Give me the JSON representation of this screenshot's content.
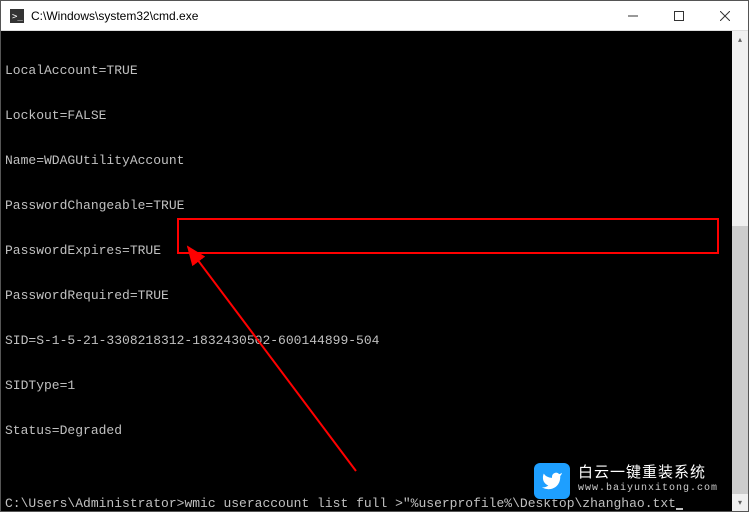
{
  "titlebar": {
    "title": "C:\\Windows\\system32\\cmd.exe"
  },
  "output": {
    "lines": [
      "LocalAccount=TRUE",
      "Lockout=FALSE",
      "Name=WDAGUtilityAccount",
      "PasswordChangeable=TRUE",
      "PasswordExpires=TRUE",
      "PasswordRequired=TRUE",
      "SID=S-1-5-21-3308218312-1832430502-600144899-504",
      "SIDType=1",
      "Status=Degraded"
    ]
  },
  "prompt": {
    "path": "C:\\Users\\Administrator>",
    "command": "wmic useraccount list full >\"%userprofile%\\Desktop\\zhanghao.txt"
  },
  "watermark": {
    "main": "白云一键重装系统",
    "sub": "www.baiyunxitong.com"
  },
  "annotation": {
    "highlight_color": "#ff0000"
  }
}
